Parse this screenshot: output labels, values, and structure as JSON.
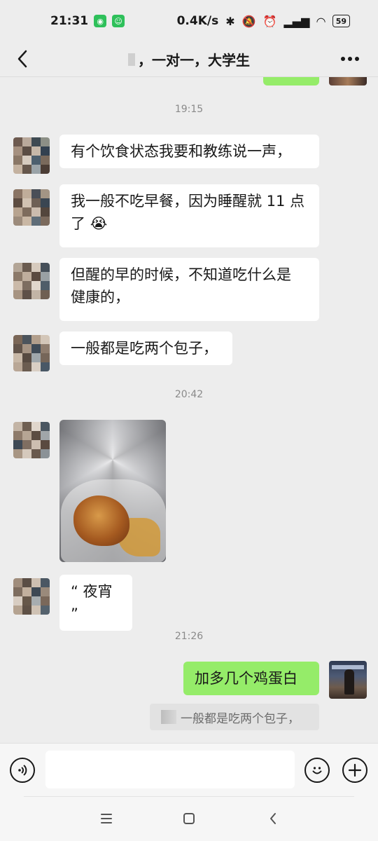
{
  "status_bar": {
    "time": "21:31",
    "network_speed": "0.4K/s",
    "battery": "59",
    "icons": [
      "wechat-icon",
      "app-icon",
      "bluetooth-icon",
      "mute-icon",
      "alarm-icon",
      "signal-icon",
      "wifi-icon",
      "battery-icon"
    ]
  },
  "header": {
    "title": "，一对一，大学生"
  },
  "chat": {
    "timestamps": [
      "19:15",
      "20:42",
      "21:26"
    ],
    "messages": [
      {
        "sender": "other",
        "text": "有个饮食状态我要和教练说一声，",
        "line1": "有个饮食状态我要和教练说一声，"
      },
      {
        "sender": "other",
        "line1": "我一般不吃早餐，因为睡醒就 11 点",
        "line2": "了",
        "emoji": "😭"
      },
      {
        "sender": "other",
        "line1": "但醒的早的时候，不知道吃什么是",
        "line2": "健康的，"
      },
      {
        "sender": "other",
        "line1": "一般都是吃两个包子，"
      },
      {
        "sender": "other",
        "type": "image"
      },
      {
        "sender": "other",
        "line1": "“ 夜宵 ”"
      },
      {
        "sender": "self",
        "line1": "加多几个鸡蛋白"
      }
    ],
    "quote": "一般都是吃两个包子，"
  },
  "input": {
    "value": "",
    "placeholder": ""
  },
  "colors": {
    "self_bubble": "#95ec69",
    "other_bubble": "#ffffff",
    "background": "#ededed"
  }
}
